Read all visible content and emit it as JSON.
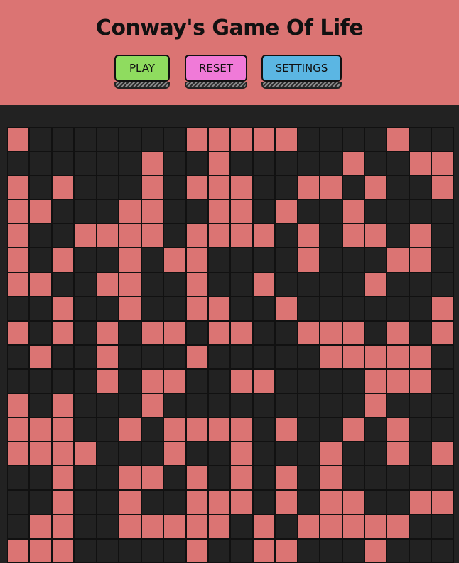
{
  "title": "Conway's Game Of Life",
  "buttons": {
    "play": "PLAY",
    "reset": "RESET",
    "settings": "SETTINGS"
  },
  "colors": {
    "header_bg": "#db7473",
    "alive": "#db7473",
    "dead": "#222222",
    "play": "#8fdc5f",
    "reset": "#f07ad8",
    "settings": "#5bb6e3"
  },
  "board": {
    "cols": 20,
    "rows": [
      "10000000111110000100",
      "00000010010000010011",
      "10100010111001101001",
      "11000110011010010000",
      "10011110111101011010",
      "10100101100001000110",
      "11001100100100001000",
      "00100100110010000001",
      "10101011011001110101",
      "01001000100000111110",
      "00001011001100001110",
      "10100010000000001000",
      "11100101111010010100",
      "11110001001000100101",
      "00100110101010100000",
      "00100100111010110011",
      "01100111110101111100",
      "11100000100110001000"
    ]
  }
}
